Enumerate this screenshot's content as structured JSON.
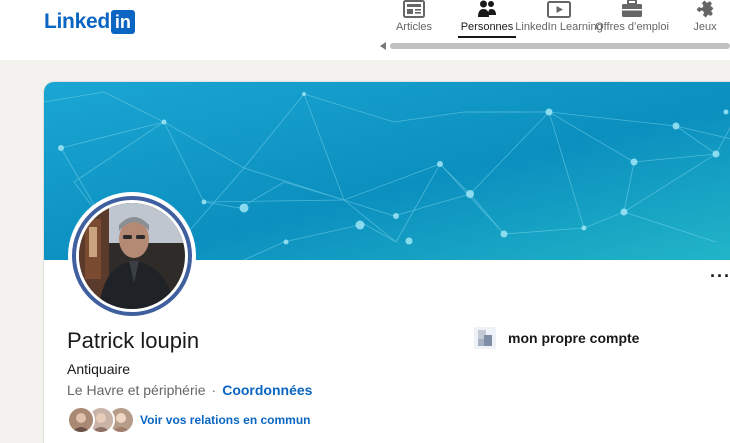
{
  "header": {
    "logo_text": "Linked",
    "logo_box_text": "in",
    "brand_color": "#0a66c2",
    "nav": [
      {
        "label": "Articles",
        "icon": "articles-icon",
        "active": false
      },
      {
        "label": "Personnes",
        "icon": "people-icon",
        "active": true
      },
      {
        "label": "LinkedIn Learning",
        "icon": "learning-play-icon",
        "active": false
      },
      {
        "label": "Offres d’emploi",
        "icon": "briefcase-icon",
        "active": false
      },
      {
        "label": "Jeux",
        "icon": "puzzle-icon",
        "active": false
      }
    ]
  },
  "profile": {
    "name": "Patrick loupin",
    "headline": "Antiquaire",
    "location": "Le Havre et périphérie",
    "separator": "·",
    "contact_link": "Coordonnées",
    "mutual_link": "Voir vos relations en commun",
    "company": "mon propre compte",
    "more_menu": "···",
    "banner_colors": [
      "#1aa4cf",
      "#0d8fbf",
      "#1fb3c9"
    ]
  }
}
